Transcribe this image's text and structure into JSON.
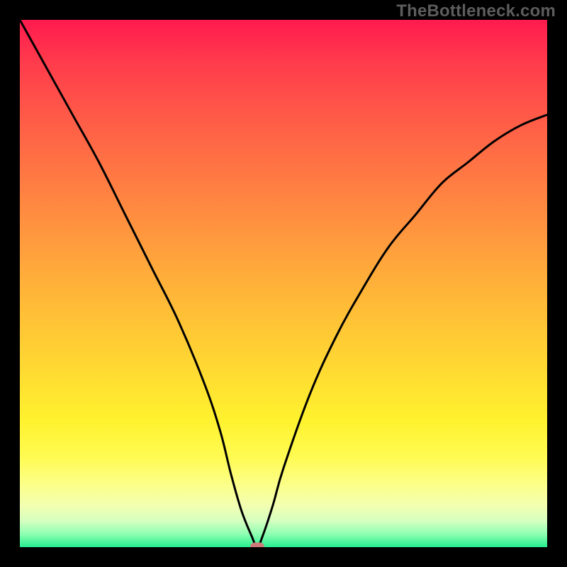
{
  "watermark": "TheBottleneck.com",
  "chart_data": {
    "type": "line",
    "title": "",
    "xlabel": "",
    "ylabel": "",
    "xlim": [
      0,
      100
    ],
    "ylim": [
      0,
      100
    ],
    "grid": false,
    "legend": false,
    "gradient_stops": [
      {
        "pct": 0,
        "color": "#ff1a4e"
      },
      {
        "pct": 8,
        "color": "#ff3b4c"
      },
      {
        "pct": 18,
        "color": "#ff5948"
      },
      {
        "pct": 30,
        "color": "#ff7a43"
      },
      {
        "pct": 42,
        "color": "#ff9b3e"
      },
      {
        "pct": 54,
        "color": "#ffbb37"
      },
      {
        "pct": 66,
        "color": "#ffd932"
      },
      {
        "pct": 76,
        "color": "#fff22e"
      },
      {
        "pct": 83,
        "color": "#fffb53"
      },
      {
        "pct": 88,
        "color": "#fcff87"
      },
      {
        "pct": 92,
        "color": "#f3ffb0"
      },
      {
        "pct": 95,
        "color": "#d6ffc0"
      },
      {
        "pct": 97.5,
        "color": "#8fffb2"
      },
      {
        "pct": 100,
        "color": "#25ee8f"
      }
    ],
    "series": [
      {
        "name": "bottleneck-curve",
        "x": [
          0,
          5,
          10,
          15,
          20,
          25,
          30,
          35,
          38,
          40,
          42,
          44,
          45,
          46,
          48,
          50,
          55,
          60,
          65,
          70,
          75,
          80,
          85,
          90,
          95,
          100
        ],
        "y": [
          100,
          91,
          82,
          73,
          63,
          53,
          43,
          31,
          22,
          14,
          7,
          2,
          0,
          2,
          8,
          15,
          29,
          40,
          49,
          57,
          63,
          69,
          73,
          77,
          80,
          82
        ]
      }
    ],
    "marker": {
      "x": 45,
      "y": 0,
      "color": "#cf7a7a"
    }
  }
}
